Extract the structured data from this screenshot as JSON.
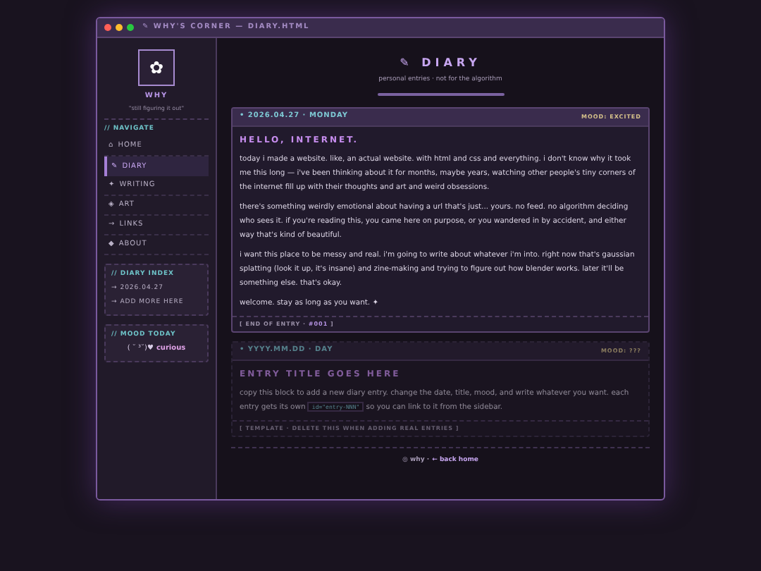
{
  "window": {
    "title": "✎ WHY'S CORNER — DIARY.HTML"
  },
  "sidebar": {
    "avatar_glyph": "✿",
    "name": "WHY",
    "tagline": "\"still figuring it out\"",
    "nav_heading": "// NAVIGATE",
    "nav": [
      {
        "icon": "⌂",
        "label": "HOME",
        "selected": false
      },
      {
        "icon": "✎",
        "label": "DIARY",
        "selected": true
      },
      {
        "icon": "✦",
        "label": "WRITING",
        "selected": false
      },
      {
        "icon": "◈",
        "label": "ART",
        "selected": false
      },
      {
        "icon": "→",
        "label": "LINKS",
        "selected": false
      },
      {
        "icon": "◆",
        "label": "ABOUT",
        "selected": false
      }
    ],
    "index": {
      "heading": "// DIARY INDEX",
      "items": [
        "→ 2026.04.27",
        "→ ADD MORE HERE"
      ]
    },
    "mood": {
      "heading": "// MOOD TODAY",
      "face": "( ˘ ³˘)♥",
      "word": "curious"
    }
  },
  "header": {
    "title": "✎ DIARY",
    "subtitle": "personal entries · not for the algorithm"
  },
  "entries": [
    {
      "kind": "real",
      "date": "• 2026.04.27 · MONDAY",
      "mood": "MOOD: EXCITED",
      "title": "HELLO, INTERNET.",
      "paragraphs": [
        "today i made a website. like, an actual website. with html and css and everything. i don't know why it took me this long — i've been thinking about it for months, maybe years, watching other people's tiny corners of the internet fill up with their thoughts and art and weird obsessions.",
        "there's something weirdly emotional about having a url that's just... yours. no feed. no algorithm deciding who sees it. if you're reading this, you came here on purpose, or you wandered in by accident, and either way that's kind of beautiful.",
        "i want this place to be messy and real. i'm going to write about whatever i'm into. right now that's gaussian splatting (look it up, it's insane) and zine-making and trying to figure out how blender works. later it'll be something else. that's okay.",
        "welcome. stay as long as you want. ✦"
      ],
      "footer": "[ END OF ENTRY · ",
      "footer_id": "#001",
      "footer_end": " ]"
    },
    {
      "kind": "template",
      "date": "• YYYY.MM.DD · DAY",
      "mood": "MOOD: ???",
      "title": "ENTRY TITLE GOES HERE",
      "paragraphs": [
        "copy this block to add a new diary entry. change the date, title, mood, and write whatever you want. each entry gets its own "
      ],
      "code": "id=\"entry-NNN\"",
      "after_code": " so you can link to it from the sidebar.",
      "footer": "[ TEMPLATE · DELETE THIS WHEN ADDING REAL ENTRIES ]"
    }
  ],
  "page_footer": {
    "text": "◎ why ·",
    "link": "← back home"
  }
}
